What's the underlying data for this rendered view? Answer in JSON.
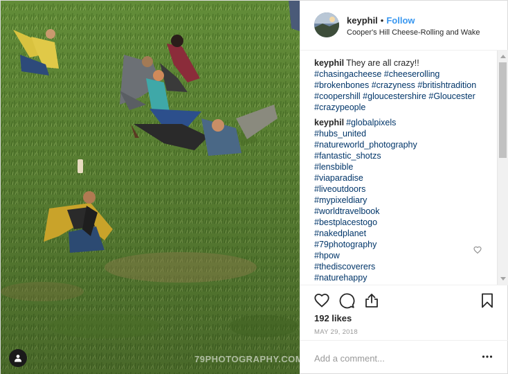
{
  "header": {
    "username": "keyphil",
    "separator": "•",
    "follow_label": "Follow",
    "location": "Cooper's Hill Cheese-Rolling and Wake"
  },
  "comments": [
    {
      "username": "keyphil",
      "text": "They are all crazy!!",
      "tags": [
        "#chasingacheese #cheeserolling",
        "#brokenbones #crazyness #britishtradition",
        "#coopershill #gloucestershire #Gloucester",
        "#crazypeople"
      ]
    },
    {
      "username": "keyphil",
      "text": "#globalpixels",
      "tags": [
        "#hubs_united",
        "#natureworld_photography",
        "#fantastic_shotzs",
        "#lensbible",
        "#viaparadise",
        "#liveoutdoors",
        "#mypixeldiary",
        "#worldtravelbook",
        "#bestplacestogo",
        "#nakedplanet",
        "#79photography",
        "#hpow",
        "#thediscoverers",
        "#naturehappy"
      ]
    }
  ],
  "likes": "192 likes",
  "date": "MAY 29, 2018",
  "comment_placeholder": "Add a comment...",
  "watermark": "79PHOTOGRAPHY.COM",
  "icons": {
    "like": "heart-icon",
    "comment": "comment-bubble-icon",
    "share": "share-icon",
    "save": "bookmark-icon",
    "more": "more-options-icon",
    "user_tag": "user-tag-icon",
    "comment_like": "small-heart-icon"
  },
  "colors": {
    "link": "#003569",
    "follow": "#3897f0",
    "muted": "#999999",
    "text": "#262626"
  }
}
